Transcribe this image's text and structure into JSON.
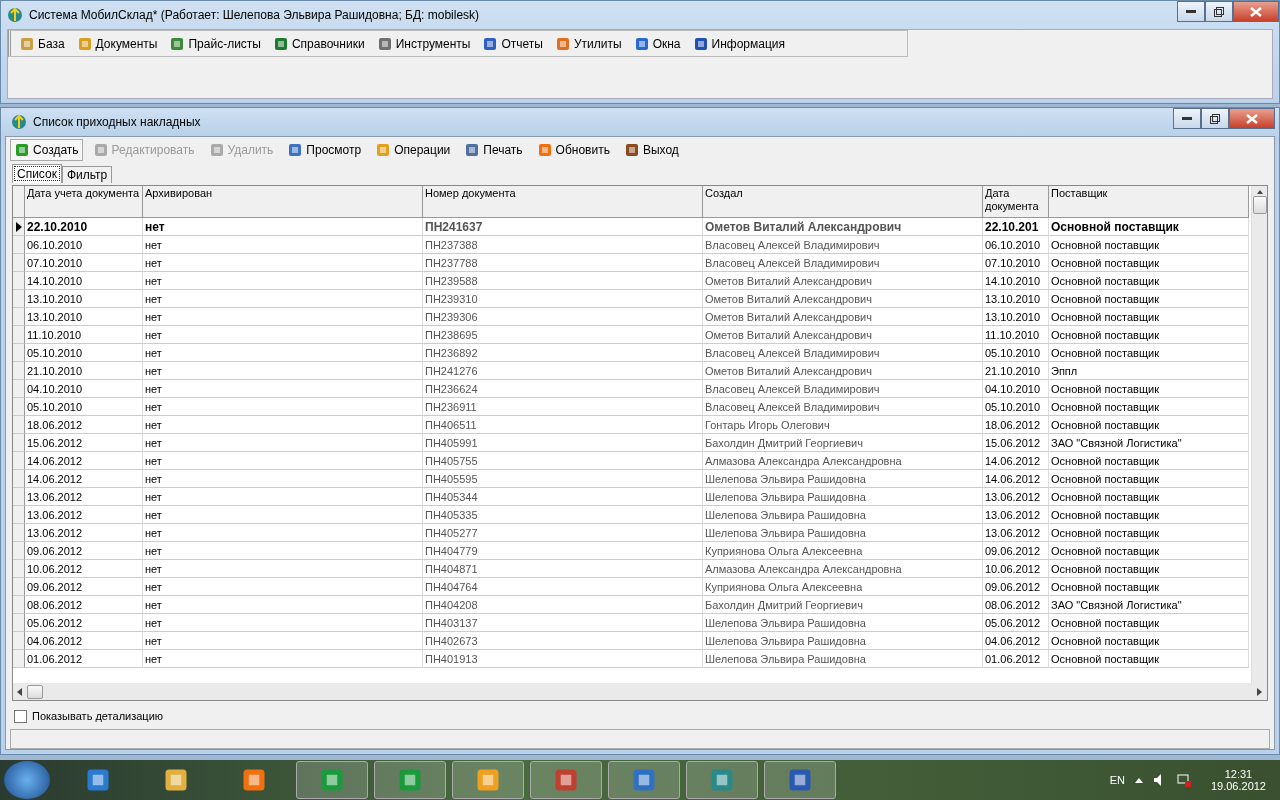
{
  "main_window": {
    "title": "Система МобилСклад* (Работает: Шелепова Эльвира Рашидовна; БД: mobilesk)"
  },
  "menu": [
    {
      "label": "База"
    },
    {
      "label": "Документы"
    },
    {
      "label": "Прайс-листы"
    },
    {
      "label": "Справочники"
    },
    {
      "label": "Инструменты"
    },
    {
      "label": "Отчеты"
    },
    {
      "label": "Утилиты"
    },
    {
      "label": "Окна"
    },
    {
      "label": "Информация"
    }
  ],
  "child_window": {
    "title": "Список приходных накладных"
  },
  "toolbar": [
    {
      "label": "Создать",
      "disabled": false
    },
    {
      "label": "Редактировать",
      "disabled": true
    },
    {
      "label": "Удалить",
      "disabled": true
    },
    {
      "label": "Просмотр",
      "disabled": false
    },
    {
      "label": "Операции",
      "disabled": false
    },
    {
      "label": "Печать",
      "disabled": false
    },
    {
      "label": "Обновить",
      "disabled": false
    },
    {
      "label": "Выход",
      "disabled": false
    }
  ],
  "tabs": [
    {
      "label": "Список",
      "selected": true
    },
    {
      "label": "Фильтр",
      "selected": false
    }
  ],
  "table": {
    "columns": [
      "Дата учета документа",
      "Архивирован",
      "Номер документа",
      "Создал",
      "Дата документа",
      "Поставщик"
    ],
    "rows": [
      {
        "selected": true,
        "cells": [
          "22.10.2010",
          "нет",
          "ПН241637",
          "Ометов Виталий Александрович",
          "22.10.201",
          "Основной поставщик"
        ]
      },
      {
        "selected": false,
        "cells": [
          "06.10.2010",
          "нет",
          "ПН237388",
          "Власовец Алексей Владимирович",
          "06.10.2010",
          "Основной поставщик"
        ]
      },
      {
        "selected": false,
        "cells": [
          "07.10.2010",
          "нет",
          "ПН237788",
          "Власовец Алексей Владимирович",
          "07.10.2010",
          "Основной поставщик"
        ]
      },
      {
        "selected": false,
        "cells": [
          "14.10.2010",
          "нет",
          "ПН239588",
          "Ометов Виталий Александрович",
          "14.10.2010",
          "Основной поставщик"
        ]
      },
      {
        "selected": false,
        "cells": [
          "13.10.2010",
          "нет",
          "ПН239310",
          "Ометов Виталий Александрович",
          "13.10.2010",
          "Основной поставщик"
        ]
      },
      {
        "selected": false,
        "cells": [
          "13.10.2010",
          "нет",
          "ПН239306",
          "Ометов Виталий Александрович",
          "13.10.2010",
          "Основной поставщик"
        ]
      },
      {
        "selected": false,
        "cells": [
          "11.10.2010",
          "нет",
          "ПН238695",
          "Ометов Виталий Александрович",
          "11.10.2010",
          "Основной поставщик"
        ]
      },
      {
        "selected": false,
        "cells": [
          "05.10.2010",
          "нет",
          "ПН236892",
          "Власовец Алексей Владимирович",
          "05.10.2010",
          "Основной поставщик"
        ]
      },
      {
        "selected": false,
        "cells": [
          "21.10.2010",
          "нет",
          "ПН241276",
          "Ометов Виталий Александрович",
          "21.10.2010",
          "Эппл"
        ]
      },
      {
        "selected": false,
        "cells": [
          "04.10.2010",
          "нет",
          "ПН236624",
          "Власовец Алексей Владимирович",
          "04.10.2010",
          "Основной поставщик"
        ]
      },
      {
        "selected": false,
        "cells": [
          "05.10.2010",
          "нет",
          "ПН236911",
          "Власовец Алексей Владимирович",
          "05.10.2010",
          "Основной поставщик"
        ]
      },
      {
        "selected": false,
        "cells": [
          "18.06.2012",
          "нет",
          "ПН406511",
          "Гонтарь Игорь Олегович",
          "18.06.2012",
          "Основной поставщик"
        ]
      },
      {
        "selected": false,
        "cells": [
          "15.06.2012",
          "нет",
          "ПН405991",
          "Бахолдин Дмитрий Георгиевич",
          "15.06.2012",
          "ЗАО \"Связной Логистика\""
        ]
      },
      {
        "selected": false,
        "cells": [
          "14.06.2012",
          "нет",
          "ПН405755",
          "Алмазова Александра Александровна",
          "14.06.2012",
          "Основной поставщик"
        ]
      },
      {
        "selected": false,
        "cells": [
          "14.06.2012",
          "нет",
          "ПН405595",
          "Шелепова Эльвира Рашидовна",
          "14.06.2012",
          "Основной поставщик"
        ]
      },
      {
        "selected": false,
        "cells": [
          "13.06.2012",
          "нет",
          "ПН405344",
          "Шелепова Эльвира Рашидовна",
          "13.06.2012",
          "Основной поставщик"
        ]
      },
      {
        "selected": false,
        "cells": [
          "13.06.2012",
          "нет",
          "ПН405335",
          "Шелепова Эльвира Рашидовна",
          "13.06.2012",
          "Основной поставщик"
        ]
      },
      {
        "selected": false,
        "cells": [
          "13.06.2012",
          "нет",
          "ПН405277",
          "Шелепова Эльвира Рашидовна",
          "13.06.2012",
          "Основной поставщик"
        ]
      },
      {
        "selected": false,
        "cells": [
          "09.06.2012",
          "нет",
          "ПН404779",
          "Куприянова Ольга Алексеевна",
          "09.06.2012",
          "Основной поставщик"
        ]
      },
      {
        "selected": false,
        "cells": [
          "10.06.2012",
          "нет",
          "ПН404871",
          "Алмазова Александра Александровна",
          "10.06.2012",
          "Основной поставщик"
        ]
      },
      {
        "selected": false,
        "cells": [
          "09.06.2012",
          "нет",
          "ПН404764",
          "Куприянова Ольга Алексеевна",
          "09.06.2012",
          "Основной поставщик"
        ]
      },
      {
        "selected": false,
        "cells": [
          "08.06.2012",
          "нет",
          "ПН404208",
          "Бахолдин Дмитрий Георгиевич",
          "08.06.2012",
          "ЗАО \"Связной Логистика\""
        ]
      },
      {
        "selected": false,
        "cells": [
          "05.06.2012",
          "нет",
          "ПН403137",
          "Шелепова Эльвира Рашидовна",
          "05.06.2012",
          "Основной поставщик"
        ]
      },
      {
        "selected": false,
        "cells": [
          "04.06.2012",
          "нет",
          "ПН402673",
          "Шелепова Эльвира Рашидовна",
          "04.06.2012",
          "Основной поставщик"
        ]
      },
      {
        "selected": false,
        "cells": [
          "01.06.2012",
          "нет",
          "ПН401913",
          "Шелепова Эльвира Рашидовна",
          "01.06.2012",
          "Основной поставщик"
        ]
      }
    ]
  },
  "show_details": {
    "label": "Показывать детализацию",
    "checked": false
  },
  "taskbar": {
    "apps": [
      {
        "active": false
      },
      {
        "active": false
      },
      {
        "active": false
      },
      {
        "active": true
      },
      {
        "active": true
      },
      {
        "active": true
      },
      {
        "active": true
      },
      {
        "active": true
      },
      {
        "active": true
      },
      {
        "active": true
      }
    ],
    "language": "EN",
    "time": "12:31",
    "date": "19.06.2012"
  }
}
